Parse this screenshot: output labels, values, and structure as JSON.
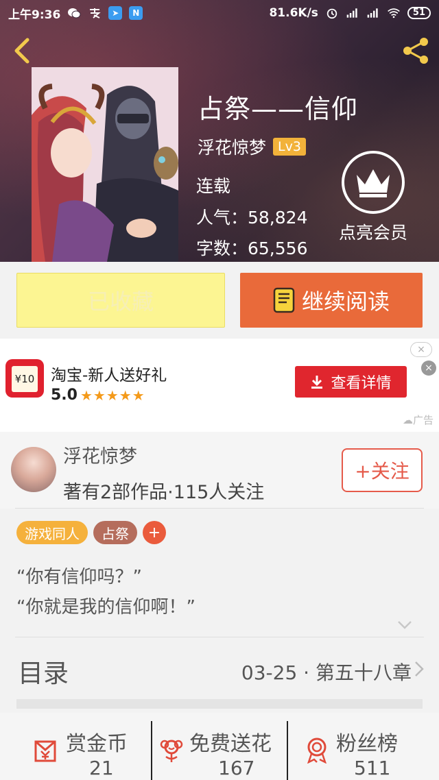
{
  "status_bar": {
    "time": "上午9:36",
    "network_speed": "81.6K/s",
    "battery": "51"
  },
  "book": {
    "title": "占祭——信仰",
    "author": "浮花惊梦",
    "level": "Lv3",
    "status": "连载",
    "popularity": "人气：58,824",
    "word_count": "字数：65,556"
  },
  "vip": {
    "label": "点亮会员"
  },
  "actions": {
    "collected_label": "已收藏",
    "continue_label": "继续阅读"
  },
  "ad": {
    "icon_text": "¥10",
    "title": "淘宝-新人送好礼",
    "rating": "5.0",
    "stars": "★★★★★",
    "cta_label": "查看详情",
    "close_outline": "×",
    "close_filled": "×",
    "ad_label": "广告"
  },
  "author_card": {
    "name": "浮花惊梦",
    "stats": "著有2部作品·115人关注",
    "follow_label": "+关注"
  },
  "tags": [
    {
      "label": "游戏同人"
    },
    {
      "label": "占祭"
    },
    {
      "label": "+"
    }
  ],
  "summary": {
    "line1": "“你有信仰吗？”",
    "line2": "“你就是我的信仰啊！”"
  },
  "toc": {
    "title": "目录",
    "latest": "03-25 · 第五十八章"
  },
  "stats": [
    {
      "label": "赏金币",
      "value": "21",
      "icon": "reward-coin-icon"
    },
    {
      "label": "免费送花",
      "value": "167",
      "icon": "flower-icon"
    },
    {
      "label": "粉丝榜",
      "value": "511",
      "icon": "ranking-medal-icon"
    }
  ],
  "colors": {
    "accent_orange": "#e96a3a",
    "collected_yellow": "#fcf592",
    "level_badge": "#f2b23a",
    "ad_red": "#e0262e",
    "follow_red": "#e55a4a"
  }
}
